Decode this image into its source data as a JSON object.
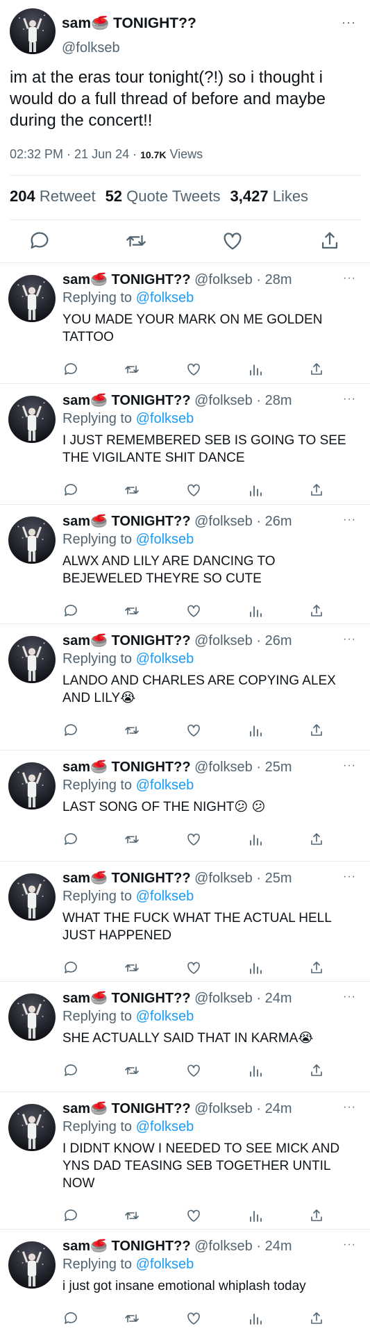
{
  "colors": {
    "link": "#1d9bf0",
    "muted": "#536471",
    "text": "#0f1419",
    "divider": "#e6ecf0"
  },
  "main_tweet": {
    "display_name": "sam🥌 TONIGHT??",
    "handle": "@folkseb",
    "more_label": "···",
    "text": "im at the eras tour tonight(?!) so i thought i would do a full thread of before and maybe during the concert!!",
    "time": "02:32 PM · 21 Jun 24 · ",
    "views_count": "10.7K",
    "views_label": " Views",
    "retweets_count": "204",
    "retweets_label": "Retweet",
    "quotes_count": "52",
    "quotes_label": "Quote Tweets",
    "likes_count": "3,427",
    "likes_label": "Likes",
    "actions": [
      "reply-icon",
      "retweet-icon",
      "like-icon",
      "share-icon"
    ]
  },
  "replies": [
    {
      "name": "sam🥌 TONIGHT??",
      "handle": "@folkseb",
      "time": "· 28m",
      "replying_label": "Replying to ",
      "replying_to": "@folkseb",
      "text": "YOU MADE YOUR MARK ON ME GOLDEN TATTOO"
    },
    {
      "name": "sam🥌 TONIGHT??",
      "handle": "@folkseb",
      "time": "· 28m",
      "replying_label": "Replying to ",
      "replying_to": "@folkseb",
      "text": "I JUST REMEMBERED SEB IS GOING TO SEE THE VIGILANTE SHIT DANCE"
    },
    {
      "name": "sam🥌 TONIGHT??",
      "handle": "@folkseb",
      "time": "· 26m",
      "replying_label": "Replying to ",
      "replying_to": "@folkseb",
      "text": "ALWX AND LILY ARE DANCING TO BEJEWELED THEYRE SO CUTE"
    },
    {
      "name": "sam🥌 TONIGHT??",
      "handle": "@folkseb",
      "time": "· 26m",
      "replying_label": "Replying to ",
      "replying_to": "@folkseb",
      "text": "LANDO AND CHARLES ARE COPYING ALEX AND LILY😭"
    },
    {
      "name": "sam🥌 TONIGHT??",
      "handle": "@folkseb",
      "time": "· 25m",
      "replying_label": "Replying to ",
      "replying_to": "@folkseb",
      "text": "LAST SONG OF THE NIGHT😕 😕"
    },
    {
      "name": "sam🥌 TONIGHT??",
      "handle": "@folkseb",
      "time": "· 25m",
      "replying_label": "Replying to ",
      "replying_to": "@folkseb",
      "text": "WHAT THE FUCK WHAT THE ACTUAL HELL JUST HAPPENED"
    },
    {
      "name": "sam🥌 TONIGHT??",
      "handle": "@folkseb",
      "time": "· 24m",
      "replying_label": "Replying to ",
      "replying_to": "@folkseb",
      "text": "SHE ACTUALLY SAID THAT IN KARMA😭"
    },
    {
      "name": "sam🥌 TONIGHT??",
      "handle": "@folkseb",
      "time": "· 24m",
      "replying_label": "Replying to ",
      "replying_to": "@folkseb",
      "text": "I DIDNT KNOW I NEEDED TO SEE MICK AND YNS DAD TEASING SEB TOGETHER UNTIL NOW"
    },
    {
      "name": "sam🥌 TONIGHT??",
      "handle": "@folkseb",
      "time": "· 24m",
      "replying_label": "Replying to ",
      "replying_to": "@folkseb",
      "text": "i just got insane emotional whiplash today"
    }
  ],
  "reply_actions": [
    "reply-icon",
    "retweet-icon",
    "like-icon",
    "analytics-icon",
    "share-icon"
  ]
}
